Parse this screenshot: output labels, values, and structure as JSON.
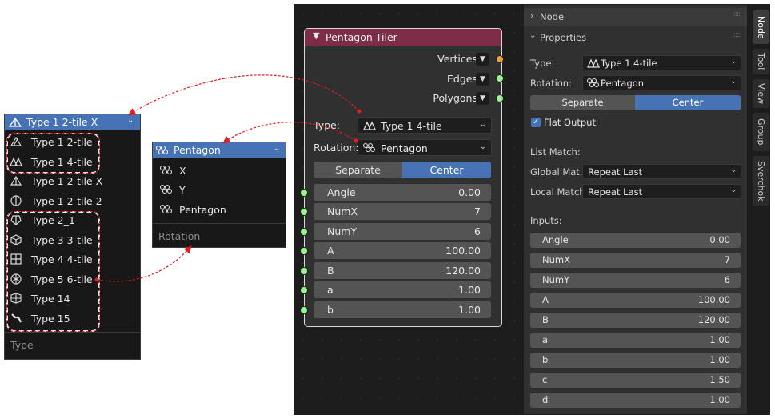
{
  "node": {
    "title": "Pentagon Tiler",
    "outputs": [
      "Vertices",
      "Edges",
      "Polygons"
    ],
    "type_label": "Type:",
    "type_value": "Type 1 4-tile",
    "rotation_label": "Rotation:",
    "rotation_value": "Pentagon",
    "mode_options": [
      "Separate",
      "Center"
    ],
    "mode_selected": "Center",
    "inputs": [
      {
        "name": "Angle",
        "value": "0.00"
      },
      {
        "name": "NumX",
        "value": "7"
      },
      {
        "name": "NumY",
        "value": "6"
      },
      {
        "name": "A",
        "value": "100.00"
      },
      {
        "name": "B",
        "value": "120.00"
      },
      {
        "name": "a",
        "value": "1.00"
      },
      {
        "name": "b",
        "value": "1.00"
      }
    ]
  },
  "type_menu": {
    "selected": "Type 1 2-tile X",
    "items": [
      "Type 1 2-tile",
      "Type 1 4-tile",
      "Type 1 2-tile X",
      "Type 1 2-tile 2",
      "Type 2_1",
      "Type 3 3-tile",
      "Type 4 4-tile",
      "Type 5 6-tile",
      "Type 14",
      "Type 15"
    ],
    "footer": "Type"
  },
  "rotation_menu": {
    "selected": "Pentagon",
    "items": [
      "X",
      "Y",
      "Pentagon"
    ],
    "footer": "Rotation"
  },
  "panel": {
    "node_header": "Node",
    "properties_header": "Properties",
    "type_label": "Type:",
    "type_value": "Type 1 4-tile",
    "rotation_label": "Rotation:",
    "rotation_value": "Pentagon",
    "mode_options": [
      "Separate",
      "Center"
    ],
    "flat_output": "Flat Output",
    "list_match": "List Match:",
    "global_label": "Global Mat...",
    "global_value": "Repeat Last",
    "local_label": "Local Match:",
    "local_value": "Repeat Last",
    "inputs_label": "Inputs:",
    "inputs": [
      {
        "name": "Angle",
        "value": "0.00"
      },
      {
        "name": "NumX",
        "value": "7"
      },
      {
        "name": "NumY",
        "value": "6"
      },
      {
        "name": "A",
        "value": "100.00"
      },
      {
        "name": "B",
        "value": "120.00"
      },
      {
        "name": "a",
        "value": "1.00"
      },
      {
        "name": "b",
        "value": "1.00"
      },
      {
        "name": "c",
        "value": "1.50"
      },
      {
        "name": "d",
        "value": "1.00"
      }
    ]
  },
  "tabs": [
    "Node",
    "Tool",
    "View",
    "Group",
    "Sverchok"
  ],
  "colors": {
    "accent": "#4772b3",
    "node_header": "#7d2d47",
    "socket_green": "#9af590",
    "socket_orange": "#e8a040",
    "annotation": "#e02020"
  }
}
